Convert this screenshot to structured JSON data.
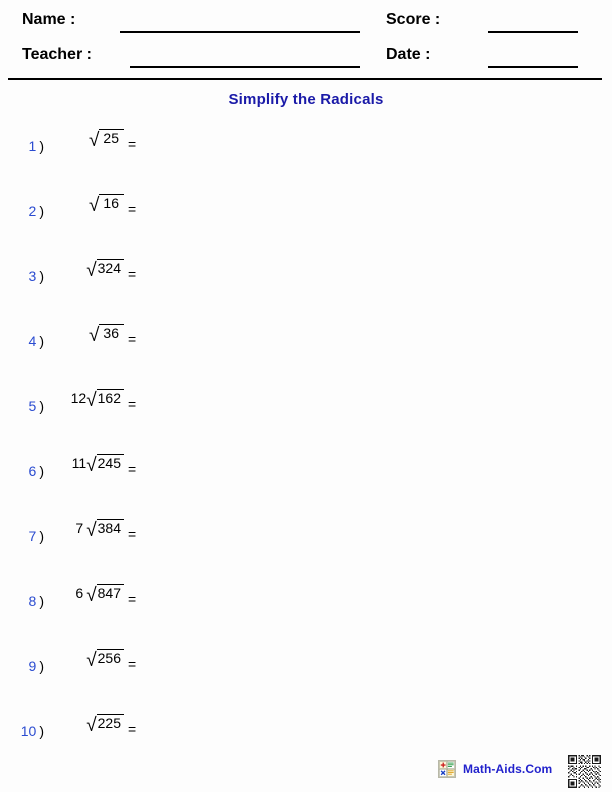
{
  "header": {
    "name_label": "Name :",
    "teacher_label": "Teacher :",
    "score_label": "Score :",
    "date_label": "Date :",
    "name_value": "",
    "teacher_value": "",
    "score_value": "",
    "date_value": ""
  },
  "title": "Simplify the Radicals",
  "problems": [
    {
      "number": "1",
      "paren": ")",
      "coefficient": "",
      "radicand": "25",
      "equals": "="
    },
    {
      "number": "2",
      "paren": ")",
      "coefficient": "",
      "radicand": "16",
      "equals": "="
    },
    {
      "number": "3",
      "paren": ")",
      "coefficient": "",
      "radicand": "324",
      "equals": "="
    },
    {
      "number": "4",
      "paren": ")",
      "coefficient": "",
      "radicand": "36",
      "equals": "="
    },
    {
      "number": "5",
      "paren": ")",
      "coefficient": "12",
      "radicand": "162",
      "equals": "="
    },
    {
      "number": "6",
      "paren": ")",
      "coefficient": "11",
      "radicand": "245",
      "equals": "="
    },
    {
      "number": "7",
      "paren": ")",
      "coefficient": "7",
      "radicand": "384",
      "equals": "="
    },
    {
      "number": "8",
      "paren": ")",
      "coefficient": "6",
      "radicand": "847",
      "equals": "="
    },
    {
      "number": "9",
      "paren": ")",
      "coefficient": "",
      "radicand": "256",
      "equals": "="
    },
    {
      "number": "10",
      "paren": ")",
      "coefficient": "",
      "radicand": "225",
      "equals": "="
    }
  ],
  "radical_sign": "√",
  "footer": {
    "brand_text": "Math-Aids.Com",
    "icon_name": "math-aids-logo-icon",
    "qr_name": "qr-code"
  },
  "colors": {
    "title_blue": "#1a1aa8",
    "number_blue": "#2a4bd0",
    "brand_blue": "#2222cc",
    "ink": "#000000",
    "paper": "#fdfdfd"
  }
}
